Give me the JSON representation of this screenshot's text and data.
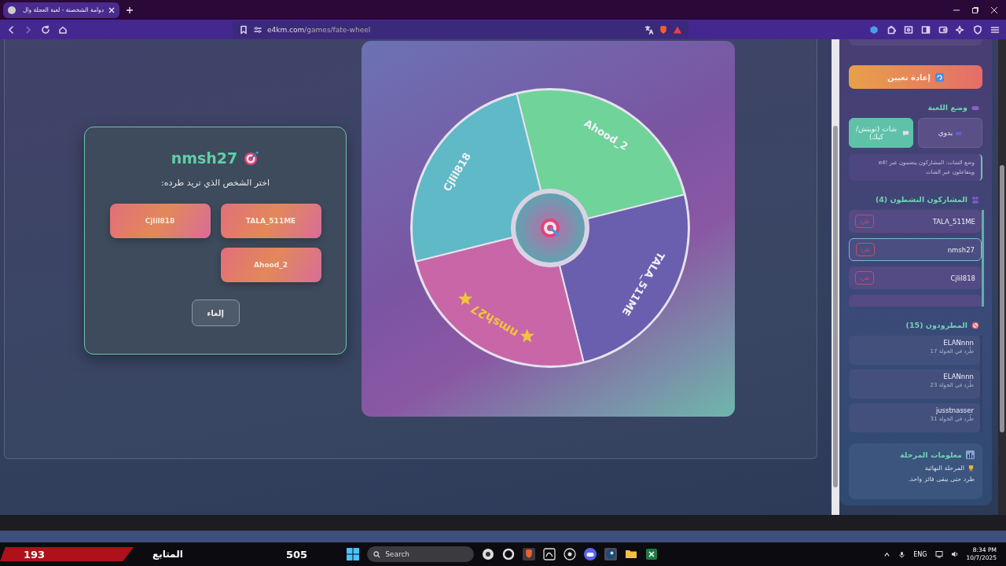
{
  "browser": {
    "tab_title": "دوامة الشخصنة - لعبة العجلة وال",
    "url_domain": "e4km.com",
    "url_path": "/games/fate-wheel"
  },
  "kick_dialog": {
    "title": "nmsh27",
    "prompt": "اختر الشخص الذي تريد طرده:",
    "choices": [
      "TALA_511ME",
      "Cjlil818",
      "Ahood_2"
    ],
    "cancel": "إلغاء"
  },
  "wheel": {
    "segments": [
      {
        "label": "Ahood_2",
        "color": "#6fd39a",
        "selected": false
      },
      {
        "label": "TALA_511ME",
        "color": "#6a5fae",
        "selected": false
      },
      {
        "label": "nmsh27",
        "color": "#c866a8",
        "selected": true
      },
      {
        "label": "Cjlil818",
        "color": "#5fb9c6",
        "selected": false
      }
    ]
  },
  "sidebar": {
    "reset_button": "إعادة تعيين",
    "mode_title": "وضع اللعبة",
    "modes": [
      {
        "label": "بدوي",
        "selected": false
      },
      {
        "label": "شات (تويتش/كيك)",
        "selected": true
      }
    ],
    "mode_note": "وضع الشات: المشاركون ينضمون عبر !e4 ويتفاعلون عبر الشات",
    "active_title": "المشاركون النشطون (4)",
    "active": [
      {
        "name": "TALA_511ME",
        "kick": "طرد",
        "selected": false
      },
      {
        "name": "nmsh27",
        "kick": "طرد",
        "selected": true
      },
      {
        "name": "Cjlil818",
        "kick": "طرد",
        "selected": false
      }
    ],
    "kicked_title": "المطرودون (15)",
    "kicked": [
      {
        "name": "ELANnnn",
        "round": "طُرد في الجولة 17"
      },
      {
        "name": "ELANnnn",
        "round": "طُرد في الجولة 23"
      },
      {
        "name": "jusstnasser",
        "round": "طُرد في الجولة 31"
      }
    ],
    "stage_title": "معلومات المرحلة",
    "stage_name": "المرحلة النهائية",
    "stage_rule": "طرد حتى يبقى فائز واحد."
  },
  "stream_overlay": {
    "count": "193",
    "label": "المتابع",
    "value": "505"
  },
  "taskbar": {
    "search": "Search",
    "language": "ENG",
    "time": "8:34 PM",
    "date": "10/7/2025"
  }
}
